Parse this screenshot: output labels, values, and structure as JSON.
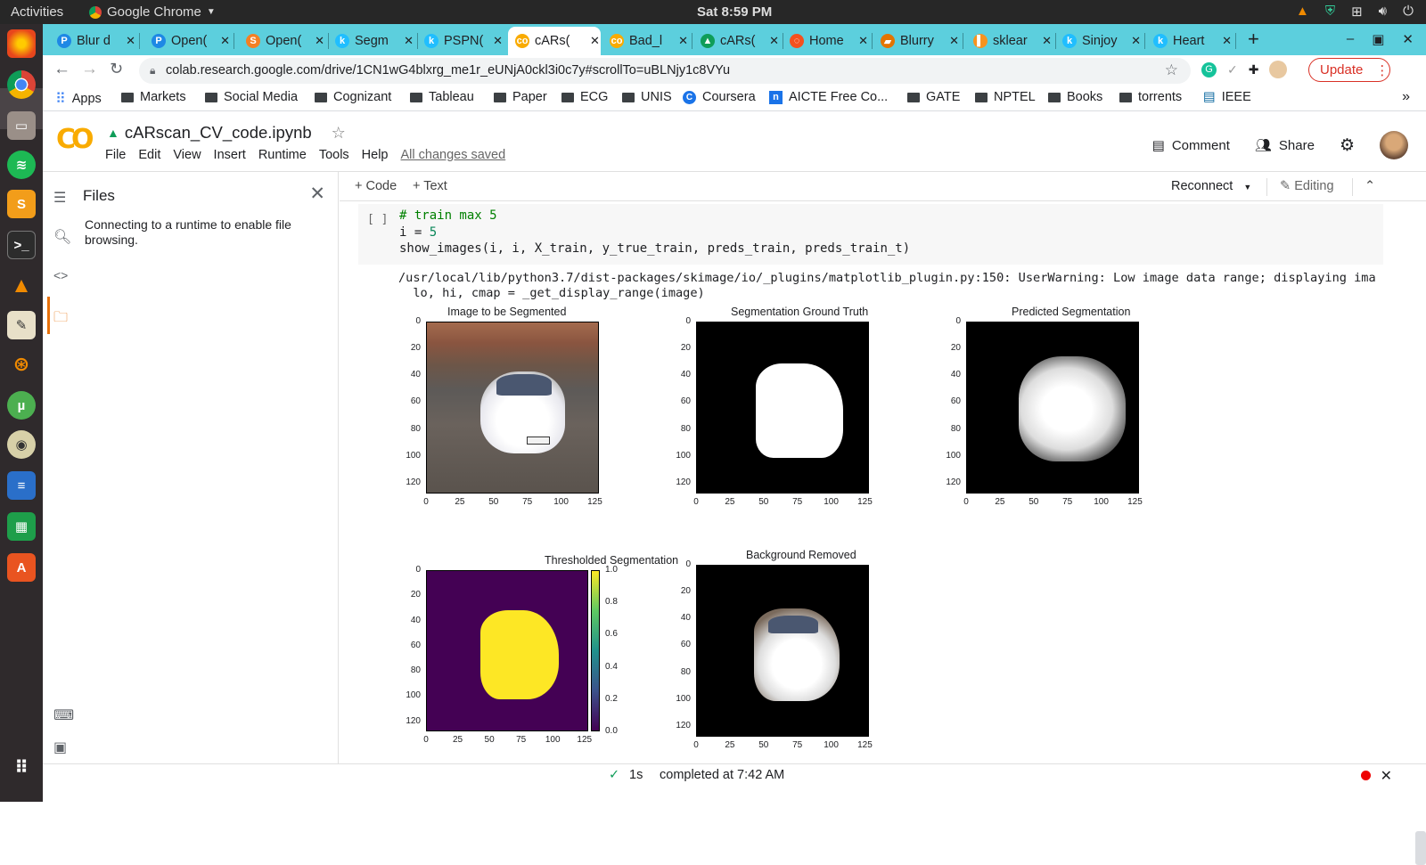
{
  "os": {
    "activities": "Activities",
    "app_name": "Google Chrome",
    "clock": "Sat  8:59 PM"
  },
  "tabs": [
    {
      "title": "Blur d",
      "icon_color": "#1e88e5",
      "icon": "P"
    },
    {
      "title": "Open(",
      "icon_color": "#1e88e5",
      "icon": "P"
    },
    {
      "title": "Open(",
      "icon_color": "#f48024",
      "icon": "S"
    },
    {
      "title": "Segm",
      "icon_color": "#20beff",
      "icon": "k"
    },
    {
      "title": "PSPN(",
      "icon_color": "#20beff",
      "icon": "k"
    },
    {
      "title": "cARs(",
      "icon_color": "#f9ab00",
      "icon": "co",
      "selected": true
    },
    {
      "title": "Bad_l",
      "icon_color": "#f9ab00",
      "icon": "co"
    },
    {
      "title": "cARs(",
      "icon_color": "#0f9d58",
      "icon": "▲"
    },
    {
      "title": "Home",
      "icon_color": "#f4511e",
      "icon": "◌"
    },
    {
      "title": "Blurry",
      "icon_color": "#e37400",
      "icon": "▰"
    },
    {
      "title": "sklear",
      "icon_color": "#f7931e",
      "icon": "▌"
    },
    {
      "title": "Sinjoy",
      "icon_color": "#20beff",
      "icon": "k"
    },
    {
      "title": "Heart",
      "icon_color": "#20beff",
      "icon": "k"
    }
  ],
  "address": {
    "url": "colab.research.google.com/drive/1CN1wG4blxrg_me1r_eUNjA0ckl3i0c7y#scrollTo=uBLNjy1c8VYu",
    "update_label": "Update"
  },
  "bookmarks": [
    {
      "label": "Apps",
      "type": "apps"
    },
    {
      "label": "Markets",
      "type": "folder"
    },
    {
      "label": "Social Media",
      "type": "folder"
    },
    {
      "label": "Cognizant",
      "type": "folder"
    },
    {
      "label": "Tableau",
      "type": "folder"
    },
    {
      "label": "Paper",
      "type": "folder"
    },
    {
      "label": "ECG",
      "type": "folder"
    },
    {
      "label": "UNIS",
      "type": "folder"
    },
    {
      "label": "Coursera",
      "type": "coursera"
    },
    {
      "label": "AICTE Free Co...",
      "type": "aicte"
    },
    {
      "label": "GATE",
      "type": "folder"
    },
    {
      "label": "NPTEL",
      "type": "folder"
    },
    {
      "label": "Books",
      "type": "folder"
    },
    {
      "label": "torrents",
      "type": "folder"
    },
    {
      "label": "IEEE",
      "type": "ieee"
    }
  ],
  "colab": {
    "logo": "CO",
    "notebook_title": "cARscan_CV_code.ipynb",
    "menus": [
      "File",
      "Edit",
      "View",
      "Insert",
      "Runtime",
      "Tools",
      "Help"
    ],
    "saved_status": "All changes saved",
    "comment_label": "Comment",
    "share_label": "Share",
    "add_code": "+ Code",
    "add_text": "+ Text",
    "reconnect": "Reconnect",
    "editing": "Editing"
  },
  "sidebar": {
    "title": "Files",
    "message": "Connecting to a runtime to enable file browsing."
  },
  "cell": {
    "bracket": "[ ]",
    "line1": "# train max 5",
    "line2_var": "i = ",
    "line2_num": "5",
    "line3": "show_images(i, i, X_train, y_true_train, preds_train, preds_train_t)",
    "warning_line1": "/usr/local/lib/python3.7/dist-packages/skimage/io/_plugins/matplotlib_plugin.py:150: UserWarning: Low image data range; displaying ima",
    "warning_line2": "  lo, hi, cmap = _get_display_range(image)"
  },
  "plots": {
    "titles": [
      "Image to be Segmented",
      "Segmentation Ground Truth",
      "Predicted Segmentation",
      "Thresholded Segmentation",
      "Background Removed"
    ],
    "yticks": [
      "0",
      "20",
      "40",
      "60",
      "80",
      "100",
      "120"
    ],
    "xticks": [
      "0",
      "25",
      "50",
      "75",
      "100",
      "125"
    ],
    "colorbar_ticks": [
      "0.0",
      "0.2",
      "0.4",
      "0.6",
      "0.8",
      "1.0"
    ],
    "colors": {
      "threshold_bg": "#440154",
      "threshold_fg": "#fde725"
    }
  },
  "status": {
    "check": "✓",
    "duration": "1s",
    "completed": "completed at 7:42 AM"
  }
}
